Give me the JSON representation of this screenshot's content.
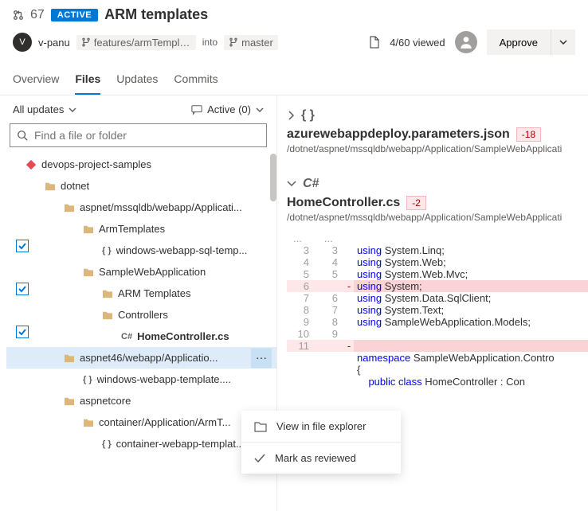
{
  "header": {
    "pr_number": "67",
    "status_badge": "ACTIVE",
    "title": "ARM templates"
  },
  "subheader": {
    "avatar_letter": "V",
    "username": "v-panu",
    "source_branch": "features/armTemplat...",
    "into": "into",
    "target_branch": "master",
    "viewed_text": "4/60 viewed",
    "approve_label": "Approve"
  },
  "tabs": {
    "overview": "Overview",
    "files": "Files",
    "updates": "Updates",
    "commits": "Commits"
  },
  "filters": {
    "all_updates": "All updates",
    "active_count": "Active (0)"
  },
  "search": {
    "placeholder": "Find a file or folder"
  },
  "tree": {
    "root": "devops-project-samples",
    "dotnet": "dotnet",
    "aspnet_path": "aspnet/mssqldb/webapp/Applicati...",
    "arm_templates": "ArmTemplates",
    "win_sql": "windows-webapp-sql-temp...",
    "sample_web": "SampleWebApplication",
    "arm_templates2": "ARM Templates",
    "controllers": "Controllers",
    "home_controller": "HomeController.cs",
    "aspnet46": "aspnet46/webapp/Applicatio...",
    "win_template": "windows-webapp-template....",
    "aspnetcore": "aspnetcore",
    "container_arm": "container/Application/ArmT...",
    "container_template": "container-webapp-templat..."
  },
  "context_menu": {
    "view_explorer": "View in file explorer",
    "mark_reviewed": "Mark as reviewed"
  },
  "files": {
    "f1": {
      "braces": "{ }",
      "title": "azurewebappdeploy.parameters.json",
      "stat": "-18",
      "path": "/dotnet/aspnet/mssqldb/webapp/Application/SampleWebApplicati"
    },
    "f2": {
      "lang": "C#",
      "title": "HomeController.cs",
      "stat": "-2",
      "path": "/dotnet/aspnet/mssqldb/webapp/Application/SampleWebApplicati"
    }
  },
  "code": {
    "l3a": "3",
    "l3b": "3",
    "l3t": "using System.Linq;",
    "l4a": "4",
    "l4b": "4",
    "l4t": "using System.Web;",
    "l5a": "5",
    "l5b": "5",
    "l5t": "using System.Web.Mvc;",
    "l6a": "6",
    "l6t": "using System;",
    "l7a": "7",
    "l7b": "6",
    "l7t": "using System.Data.SqlClient;",
    "l8a": "8",
    "l8b": "7",
    "l8t": "using System.Text;",
    "l9a": "9",
    "l9b": "8",
    "l9t": "using SampleWebApplication.Models;",
    "l10a": "10",
    "l10b": "9",
    "l11a": "11",
    "ns": "namespace SampleWebApplication.Contro",
    "brace": "{",
    "cls": "    public class HomeController : Con"
  }
}
